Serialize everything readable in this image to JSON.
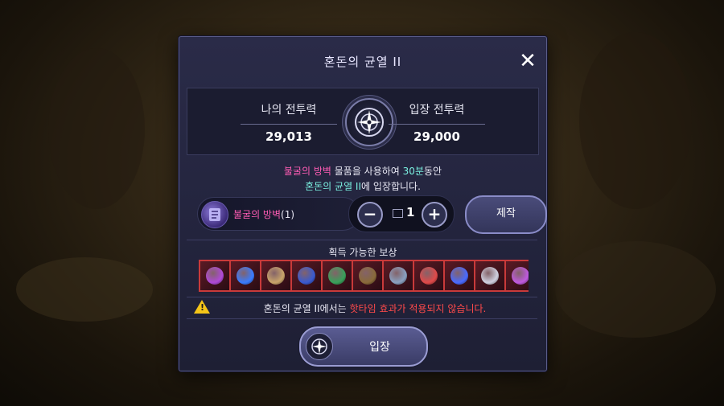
{
  "dialog": {
    "title": "혼돈의 균열 II",
    "close_label": "✕"
  },
  "power": {
    "my_label": "나의 전투력",
    "my_value": "29,013",
    "entry_label": "입장 전투력",
    "entry_value": "29,000"
  },
  "description": {
    "item_name": "불굴의 방벽",
    "text_a": " 물품을 사용하여 ",
    "duration": "30분",
    "text_b": "동안",
    "dungeon_name": "혼돈의 균열 II",
    "text_c": "에 입장합니다."
  },
  "item": {
    "name": "불굴의 방벽",
    "count": "(1)"
  },
  "stepper": {
    "minus": "−",
    "plus": "+",
    "quantity": "1"
  },
  "craft_button": "제작",
  "rewards": {
    "label": "획득 가능한 보상",
    "items": [
      {
        "icon": "purple-orb-icon",
        "color": "#b04ad8"
      },
      {
        "icon": "blue-crystal-icon",
        "color": "#3a7cff"
      },
      {
        "icon": "armor-piece-icon",
        "color": "#c9a46a"
      },
      {
        "icon": "blue-tome-icon",
        "color": "#3a5ad0"
      },
      {
        "icon": "green-tome-icon",
        "color": "#3aa05a"
      },
      {
        "icon": "treasure-chest-icon",
        "color": "#8a6a3a"
      },
      {
        "icon": "steel-chest-icon",
        "color": "#8aa0c0"
      },
      {
        "icon": "red-crystal-icon",
        "color": "#e04a4a"
      },
      {
        "icon": "blue-orb-icon",
        "color": "#4a6aff"
      },
      {
        "icon": "scroll-icon",
        "color": "#d0d0e0"
      },
      {
        "icon": "purple-sphere-icon",
        "color": "#c05ae0"
      }
    ]
  },
  "warning": {
    "dungeon_name": "혼돈의 균열 II",
    "text_a": "에서는 ",
    "highlight": "핫타임 효과가 적용되지 않습니다."
  },
  "enter_button": "입장"
}
